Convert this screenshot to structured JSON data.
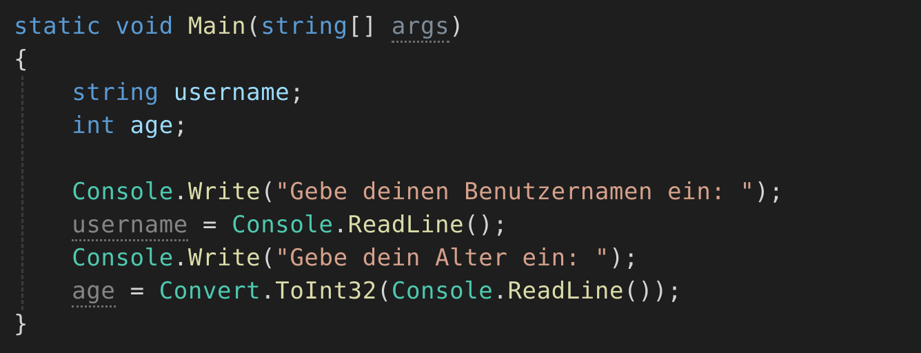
{
  "editor": {
    "language": "csharp",
    "theme": "dark",
    "background_color": "#1e1e1e",
    "font_size_px": 34,
    "line_height_px": 48,
    "indent_guide_color": "#3c3c3c",
    "colors": {
      "keyword": "#5a9bd5",
      "type": "#4ec9b0",
      "method": "#dcdcaa",
      "variable": "#9cdcfe",
      "string": "#d6a18b",
      "punctuation": "#d4d4d4",
      "unused_variable": "#7f8c99",
      "unused_gray": "#858585",
      "dotted_underline": "#6e6e6e"
    }
  },
  "code": {
    "full_text": "static void Main(string[] args)\n{\n    string username;\n    int age;\n\n    Console.Write(\"Gebe deinen Benutzernamen ein: \");\n    username = Console.ReadLine();\n    Console.Write(\"Gebe dein Alter ein: \");\n    age = Convert.ToInt32(Console.ReadLine());\n}",
    "lines": [
      {
        "index": 1,
        "text": "static void Main(string[] args)",
        "tokens": [
          {
            "t": "static",
            "c": "kw"
          },
          {
            "t": " ",
            "c": "punct"
          },
          {
            "t": "void",
            "c": "kw"
          },
          {
            "t": " ",
            "c": "punct"
          },
          {
            "t": "Main",
            "c": "method"
          },
          {
            "t": "(",
            "c": "punct"
          },
          {
            "t": "string",
            "c": "kw"
          },
          {
            "t": "[] ",
            "c": "punct"
          },
          {
            "t": "args",
            "c": "dim"
          },
          {
            "t": ")",
            "c": "punct"
          }
        ]
      },
      {
        "index": 2,
        "text": "{",
        "tokens": [
          {
            "t": "{",
            "c": "punct"
          }
        ]
      },
      {
        "index": 3,
        "text": "    string username;",
        "tokens": [
          {
            "t": "    ",
            "c": "punct"
          },
          {
            "t": "string",
            "c": "kw"
          },
          {
            "t": " ",
            "c": "punct"
          },
          {
            "t": "username",
            "c": "var"
          },
          {
            "t": ";",
            "c": "punct"
          }
        ]
      },
      {
        "index": 4,
        "text": "    int age;",
        "tokens": [
          {
            "t": "    ",
            "c": "punct"
          },
          {
            "t": "int",
            "c": "kw"
          },
          {
            "t": " ",
            "c": "punct"
          },
          {
            "t": "age",
            "c": "var"
          },
          {
            "t": ";",
            "c": "punct"
          }
        ]
      },
      {
        "index": 5,
        "text": "",
        "tokens": [
          {
            "t": " ",
            "c": "blank"
          }
        ]
      },
      {
        "index": 6,
        "text": "    Console.Write(\"Gebe deinen Benutzernamen ein: \");",
        "tokens": [
          {
            "t": "    ",
            "c": "punct"
          },
          {
            "t": "Console",
            "c": "type"
          },
          {
            "t": ".",
            "c": "punct"
          },
          {
            "t": "Write",
            "c": "method"
          },
          {
            "t": "(",
            "c": "punct"
          },
          {
            "t": "\"Gebe deinen Benutzernamen ein: \"",
            "c": "str"
          },
          {
            "t": ");",
            "c": "punct"
          }
        ]
      },
      {
        "index": 7,
        "text": "    username = Console.ReadLine();",
        "tokens": [
          {
            "t": "    ",
            "c": "punct"
          },
          {
            "t": "username",
            "c": "dim-gray"
          },
          {
            "t": " = ",
            "c": "op"
          },
          {
            "t": "Console",
            "c": "type"
          },
          {
            "t": ".",
            "c": "punct"
          },
          {
            "t": "ReadLine",
            "c": "method"
          },
          {
            "t": "();",
            "c": "punct"
          }
        ]
      },
      {
        "index": 8,
        "text": "    Console.Write(\"Gebe dein Alter ein: \");",
        "tokens": [
          {
            "t": "    ",
            "c": "punct"
          },
          {
            "t": "Console",
            "c": "type"
          },
          {
            "t": ".",
            "c": "punct"
          },
          {
            "t": "Write",
            "c": "method"
          },
          {
            "t": "(",
            "c": "punct"
          },
          {
            "t": "\"Gebe dein Alter ein: \"",
            "c": "str"
          },
          {
            "t": ");",
            "c": "punct"
          }
        ]
      },
      {
        "index": 9,
        "text": "    age = Convert.ToInt32(Console.ReadLine());",
        "tokens": [
          {
            "t": "    ",
            "c": "punct"
          },
          {
            "t": "age",
            "c": "dim-gray"
          },
          {
            "t": " = ",
            "c": "op"
          },
          {
            "t": "Convert",
            "c": "type"
          },
          {
            "t": ".",
            "c": "punct"
          },
          {
            "t": "ToInt32",
            "c": "method"
          },
          {
            "t": "(",
            "c": "punct"
          },
          {
            "t": "Console",
            "c": "type"
          },
          {
            "t": ".",
            "c": "punct"
          },
          {
            "t": "ReadLine",
            "c": "method"
          },
          {
            "t": "());",
            "c": "punct"
          }
        ]
      },
      {
        "index": 10,
        "text": "}",
        "tokens": [
          {
            "t": "}",
            "c": "punct"
          }
        ]
      }
    ]
  }
}
